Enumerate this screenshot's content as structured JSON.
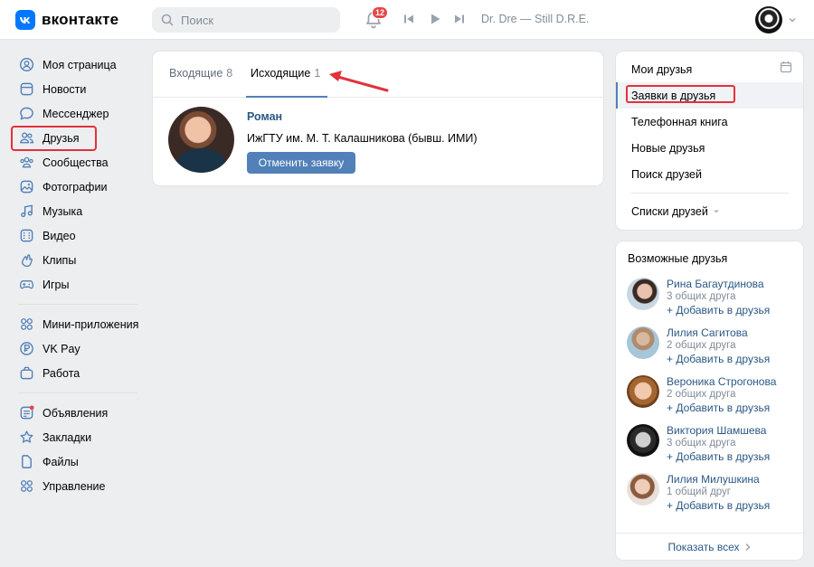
{
  "header": {
    "logo_letter": "vk",
    "logo_text": "вконтакте",
    "search_placeholder": "Поиск",
    "notifications_count": "12",
    "track": "Dr. Dre — Still D.R.E.",
    "accent": "#0077ff"
  },
  "sidebar": {
    "items": [
      {
        "label": "Моя страница",
        "icon": "user-circle-icon"
      },
      {
        "label": "Новости",
        "icon": "news-icon"
      },
      {
        "label": "Мессенджер",
        "icon": "message-icon"
      },
      {
        "label": "Друзья",
        "icon": "friends-icon"
      },
      {
        "label": "Сообщества",
        "icon": "groups-icon"
      },
      {
        "label": "Фотографии",
        "icon": "photo-icon"
      },
      {
        "label": "Музыка",
        "icon": "music-icon"
      },
      {
        "label": "Видео",
        "icon": "video-icon"
      },
      {
        "label": "Клипы",
        "icon": "clips-icon"
      },
      {
        "label": "Игры",
        "icon": "gamepad-icon"
      },
      {
        "label": "Мини-приложения",
        "icon": "apps-icon"
      },
      {
        "label": "VK Pay",
        "icon": "vkpay-icon"
      },
      {
        "label": "Работа",
        "icon": "briefcase-icon"
      },
      {
        "label": "Объявления",
        "icon": "ads-icon"
      },
      {
        "label": "Закладки",
        "icon": "star-icon"
      },
      {
        "label": "Файлы",
        "icon": "file-icon"
      },
      {
        "label": "Управление",
        "icon": "manage-icon"
      }
    ]
  },
  "main": {
    "tabs": [
      {
        "label": "Входящие",
        "count": "8"
      },
      {
        "label": "Исходящие",
        "count": "1"
      }
    ],
    "request": {
      "name": "Роман",
      "info": "ИжГТУ им. М. Т. Калашникова (бывш. ИМИ)",
      "cancel_label": "Отменить заявку"
    }
  },
  "right_nav": {
    "items": [
      "Мои друзья",
      "Заявки в друзья",
      "Телефонная книга",
      "Новые друзья",
      "Поиск друзей"
    ],
    "lists_label": "Списки друзей"
  },
  "possible_friends": {
    "title": "Возможные друзья",
    "add_label": "Добавить в друзья",
    "people": [
      {
        "name": "Рина Багаутдинова",
        "mutual": "3 общих друга"
      },
      {
        "name": "Лилия Сагитова",
        "mutual": "2 общих друга"
      },
      {
        "name": "Вероника Строгонова",
        "mutual": "2 общих друга"
      },
      {
        "name": "Виктория Шамшева",
        "mutual": "3 общих друга"
      },
      {
        "name": "Лилия Милушкина",
        "mutual": "1 общий друг"
      }
    ],
    "show_all": "Показать всех"
  }
}
